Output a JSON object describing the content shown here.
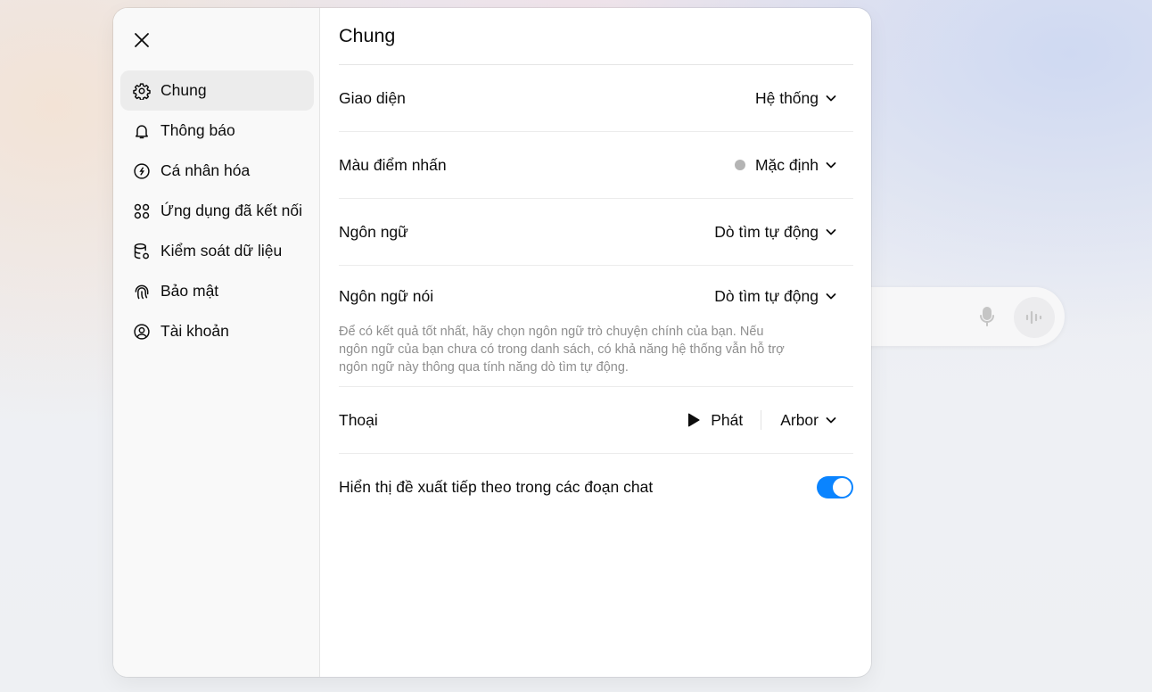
{
  "sidebar": {
    "items": [
      {
        "label": "Chung",
        "icon": "gear-icon",
        "active": true
      },
      {
        "label": "Thông báo",
        "icon": "bell-icon"
      },
      {
        "label": "Cá nhân hóa",
        "icon": "personalize-icon"
      },
      {
        "label": "Ứng dụng đã kết nối",
        "icon": "apps-icon"
      },
      {
        "label": "Kiểm soát dữ liệu",
        "icon": "database-icon"
      },
      {
        "label": "Bảo mật",
        "icon": "fingerprint-icon"
      },
      {
        "label": "Tài khoản",
        "icon": "user-circle-icon"
      }
    ]
  },
  "main": {
    "title": "Chung",
    "theme": {
      "label": "Giao diện",
      "value": "Hệ thống"
    },
    "accent": {
      "label": "Màu điểm nhấn",
      "value": "Mặc định",
      "dot_color": "#b4b4b4"
    },
    "language": {
      "label": "Ngôn ngữ",
      "value": "Dò tìm tự động"
    },
    "spoken_language": {
      "label": "Ngôn ngữ nói",
      "value": "Dò tìm tự động",
      "hint": "Để có kết quả tốt nhất, hãy chọn ngôn ngữ trò chuyện chính của bạn. Nếu ngôn ngữ của bạn chưa có trong danh sách, có khả năng hệ thống vẫn hỗ trợ ngôn ngữ này thông qua tính năng dò tìm tự động."
    },
    "voice": {
      "label": "Thoại",
      "play_label": "Phát",
      "value": "Arbor"
    },
    "follow_up": {
      "label": "Hiển thị đề xuất tiếp theo trong các đoạn chat",
      "enabled": true,
      "toggle_color": "#0a84ff"
    }
  },
  "colors": {
    "accent": "#0a84ff",
    "sidebar_bg": "#f9f9f9",
    "active_item_bg": "#ececec"
  }
}
